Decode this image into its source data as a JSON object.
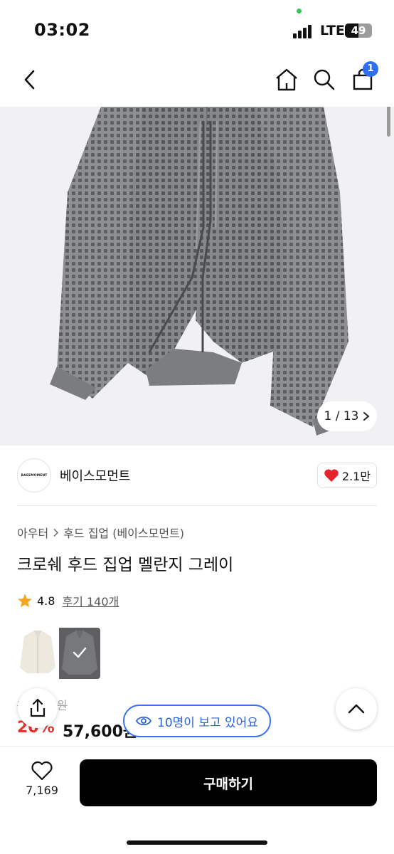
{
  "status_bar": {
    "time": "03:02",
    "network": "LTE",
    "battery": "49",
    "battery_level": 0.49
  },
  "nav": {
    "back_icon": "chevron-left-icon",
    "home_icon": "home-icon",
    "search_icon": "search-icon",
    "cart_icon": "shopping-bag-icon",
    "cart_badge": "1"
  },
  "gallery": {
    "counter": "1 / 13",
    "counter_icon": "chevron-right-icon"
  },
  "brand": {
    "logo_text": "BASEMOMENT",
    "name": "베이스모먼트",
    "likes": "2.1만",
    "like_icon": "heart-icon"
  },
  "product": {
    "category_1": "아우터",
    "category_2": "후드 집업 (베이스모먼트)",
    "title": "크로쉐 후드 집업 멜란지 그레이",
    "rating": "4.8",
    "reviews": "후기 140개",
    "original_price": "72,000원",
    "discount": "20%",
    "final_price": "57,600원"
  },
  "overlay": {
    "viewers": "10명이 보고 있어요",
    "viewers_icon": "eye-icon",
    "share_icon": "share-icon",
    "top_icon": "chevron-up-icon"
  },
  "bottom": {
    "wish_count": "7,169",
    "buy_label": "구매하기"
  },
  "colors": {
    "accent_blue": "#2f6df6",
    "sale_red": "#e8332a",
    "heart_red": "#e5232d",
    "star": "#f5a623"
  }
}
